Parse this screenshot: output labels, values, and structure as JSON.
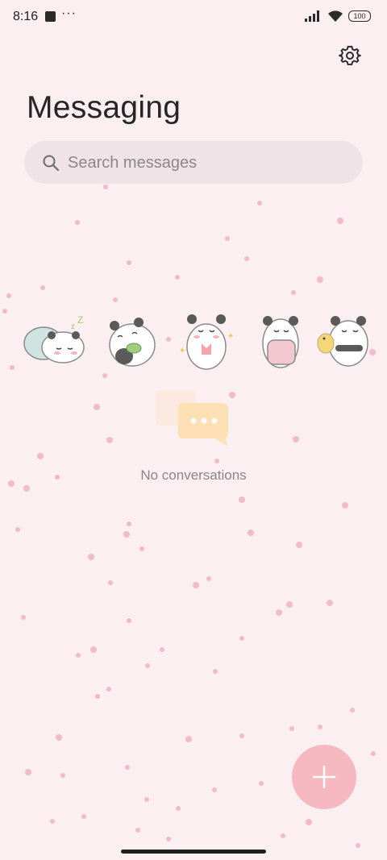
{
  "status_bar": {
    "time": "8:16",
    "more": "···",
    "battery": "100"
  },
  "header": {
    "title": "Messaging",
    "settings_icon": "gear-icon"
  },
  "search": {
    "placeholder": "Search messages",
    "icon": "search-icon"
  },
  "stickers": [
    {
      "name": "sleeping-panda"
    },
    {
      "name": "panda-with-cucumber"
    },
    {
      "name": "panda-with-pink-bow"
    },
    {
      "name": "panda-hugging-pillow"
    },
    {
      "name": "panda-with-chick"
    }
  ],
  "empty_state": {
    "icon": "chat-bubble-icon",
    "text": "No conversations"
  },
  "fab": {
    "icon": "plus-icon"
  },
  "colors": {
    "background": "#fbeff2",
    "dots": "#f2b6c3",
    "fab": "#f6b8c1",
    "chat_bubble": "#fde0b3"
  }
}
